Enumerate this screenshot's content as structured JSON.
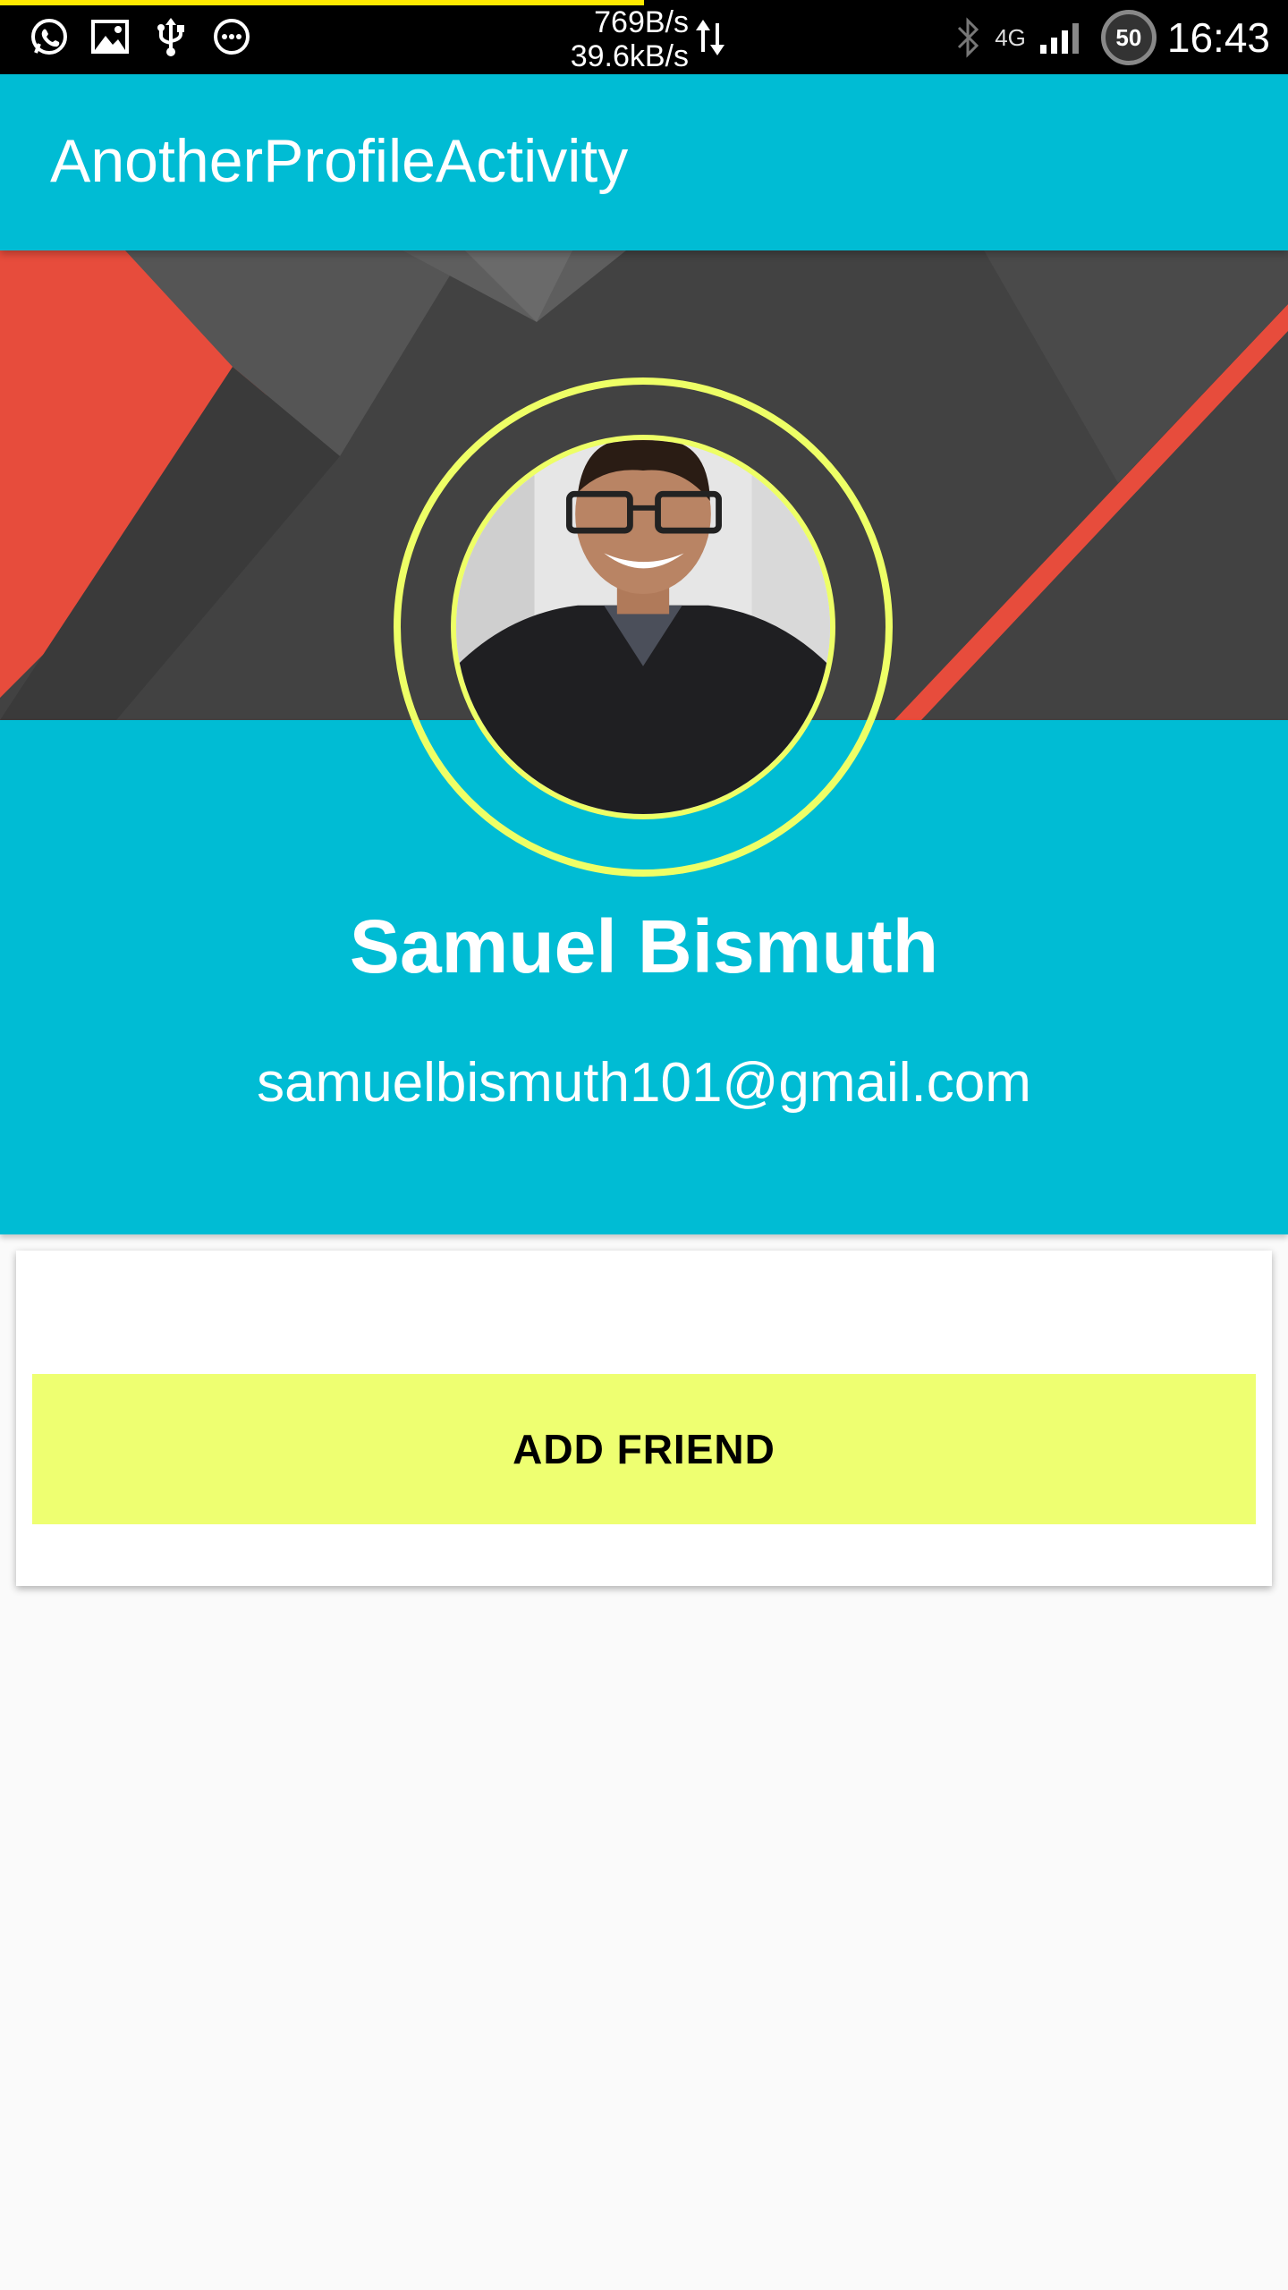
{
  "status_bar": {
    "speed_down": "769B/s",
    "speed_up": "39.6kB/s",
    "network": "4G",
    "battery": "50",
    "time": "16:43",
    "load_progress": 0.5,
    "icons": [
      "whatsapp-icon",
      "gallery-icon",
      "usb-icon",
      "more-icon",
      "data-transfer-icon",
      "bluetooth-icon",
      "signal-icon",
      "battery-icon"
    ]
  },
  "app_bar": {
    "title": "AnotherProfileActivity"
  },
  "profile": {
    "name": "Samuel Bismuth",
    "email": "samuelbismuth101@gmail.com"
  },
  "card": {
    "add_friend_label": "ADD FRIEND"
  },
  "colors": {
    "primary": "#00bcd4",
    "accent": "#eeff71",
    "ring": "#eeff66",
    "cover_dark": "#424242",
    "cover_red": "#e74c3c"
  }
}
